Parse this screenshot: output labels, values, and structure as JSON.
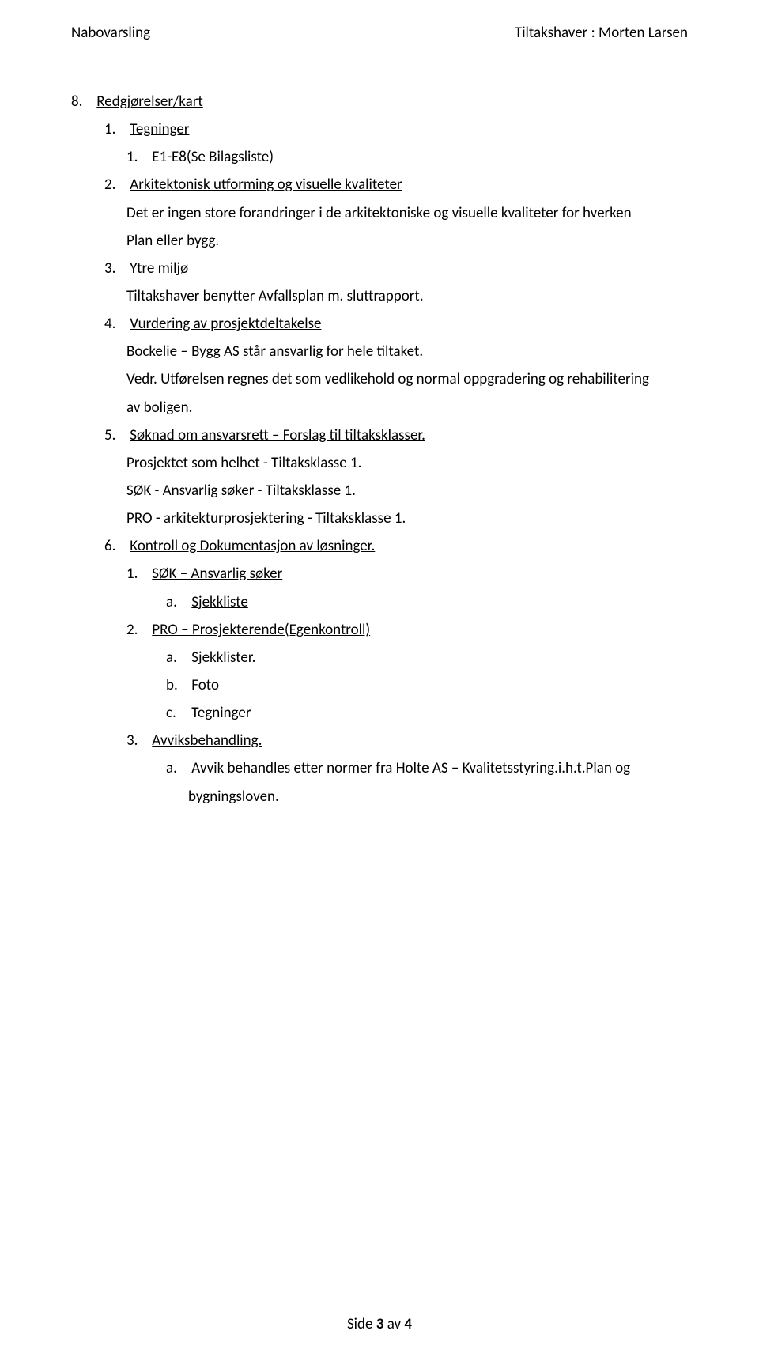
{
  "header": {
    "left": "Nabovarsling",
    "right": "Tiltakshaver : Morten Larsen"
  },
  "s8": {
    "title": "Redgjørelser/kart",
    "items": {
      "i1": {
        "title": "Tegninger",
        "sub": "E1-E8(Se Bilagsliste)"
      },
      "i2": {
        "title": "Arkitektonisk utforming og visuelle kvaliteter",
        "line1": "Det er ingen store forandringer i de arkitektoniske og visuelle kvaliteter for hverken",
        "line2": "Plan eller bygg."
      },
      "i3": {
        "title": "Ytre miljø",
        "line1": "Tiltakshaver benytter Avfallsplan m. sluttrapport."
      },
      "i4": {
        "title": "Vurdering av prosjektdeltakelse",
        "line1": "Bockelie – Bygg AS står ansvarlig for hele tiltaket.",
        "line2": "Vedr. Utførelsen regnes det som vedlikehold og normal oppgradering og rehabilitering",
        "line3": "av boligen."
      },
      "i5": {
        "title": "Søknad om ansvarsrett – Forslag til tiltaksklasser.",
        "line1": "Prosjektet som helhet - Tiltaksklasse 1.",
        "line2": "SØK - Ansvarlig søker - Tiltaksklasse 1.",
        "line3": "PRO - arkitekturprosjektering - Tiltaksklasse 1."
      },
      "i6": {
        "title": "Kontroll og Dokumentasjon av løsninger.",
        "sub1": {
          "title": "SØK – Ansvarlig søker",
          "a": "Sjekkliste"
        },
        "sub2": {
          "title": "PRO – Prosjekterende(Egenkontroll)",
          "a": "Sjekklister.",
          "b": "Foto",
          "c": "Tegninger"
        },
        "sub3": {
          "title": "Avviksbehandling.",
          "a_part1": "Avvik  behandles  etter  normer  fra  Holte  AS  –  Kvalitetsstyring.i.h.t.Plan  og",
          "a_part2": "bygningsloven."
        }
      }
    }
  },
  "footer": {
    "prefix": "Side ",
    "page": "3",
    "middle": " av ",
    "total": "4"
  }
}
